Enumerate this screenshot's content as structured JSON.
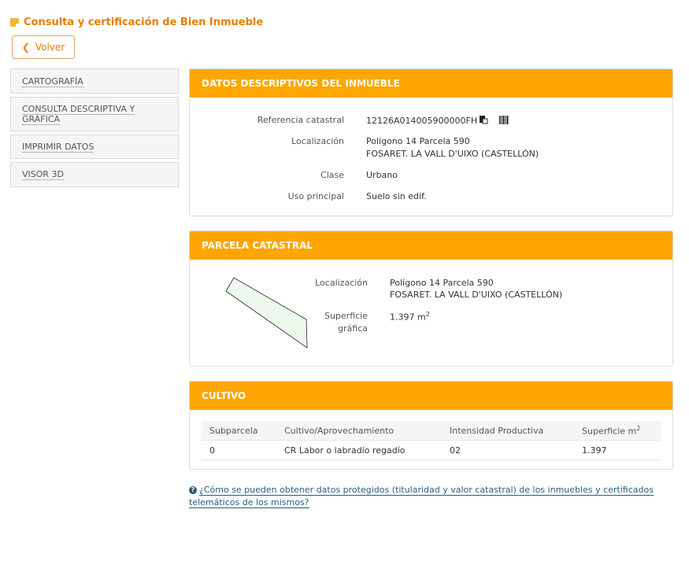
{
  "header": {
    "title": "Consulta y certificación de Bien Inmueble",
    "back_label": "Volver"
  },
  "side_menu": {
    "items": [
      {
        "label": "CARTOGRAFÍA"
      },
      {
        "label": "CONSULTA DESCRIPTIVA Y GRÁFICA"
      },
      {
        "label": "IMPRIMIR DATOS"
      },
      {
        "label": "VISOR 3D"
      }
    ]
  },
  "descriptive": {
    "title": "DATOS DESCRIPTIVOS DEL INMUEBLE",
    "ref_label": "Referencia catastral",
    "ref_value": "12126A014005900000FH",
    "loc_label": "Localización",
    "loc_line1": "Polígono 14 Parcela 590",
    "loc_line2": "FOSARET. LA VALL D'UIXO (CASTELLÓN)",
    "class_label": "Clase",
    "class_value": "Urbano",
    "use_label": "Uso principal",
    "use_value": "Suelo sin edif."
  },
  "parcel": {
    "title": "PARCELA CATASTRAL",
    "loc_label": "Localización",
    "loc_line1": "Polígono 14 Parcela 590",
    "loc_line2": "FOSARET. LA VALL D'UIXO (CASTELLÓN)",
    "area_label_1": "Superficie",
    "area_label_2": "gráfica",
    "area_value": "1.397 m",
    "area_sup": "2"
  },
  "cultivo": {
    "title": "CULTIVO",
    "headers": [
      "Subparcela",
      "Cultivo/Aprovechamiento",
      "Intensidad Productiva",
      "Superficie m"
    ],
    "header_sup": "2",
    "rows": [
      [
        "0",
        "CR Labor o labradío regadío",
        "02",
        "1.397"
      ]
    ]
  },
  "help": {
    "text_line1": "¿Cómo se pueden obtener datos protegidos (titularidad y valor catastral) de los inmuebles y certificados",
    "text_line2": "telemáticos de los mismos?"
  },
  "colors": {
    "accent": "#ffa600",
    "title": "#e57e00",
    "link": "#2a5b7a"
  }
}
